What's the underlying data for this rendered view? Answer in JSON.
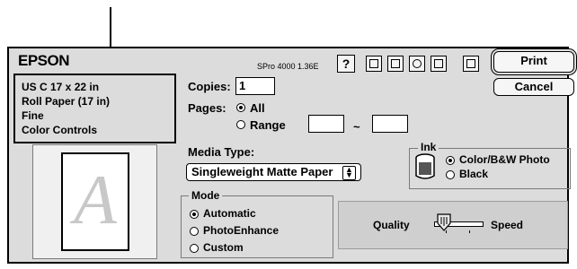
{
  "logo": "EPSON",
  "version": "SPro 4000 1.36E",
  "toolbar": {
    "help_label": "?"
  },
  "buttons": {
    "print": "Print",
    "cancel": "Cancel"
  },
  "summary": [
    "US C 17 x 22 in",
    "Roll Paper (17 in)",
    "Fine",
    "Color Controls"
  ],
  "preview": {
    "glyph": "A"
  },
  "copies": {
    "label": "Copies:",
    "value": "1"
  },
  "pages": {
    "label": "Pages:",
    "all": "All",
    "range": "Range",
    "from": "",
    "to": "",
    "sep": "~",
    "selected": "All"
  },
  "media": {
    "label": "Media Type:",
    "value": "Singleweight Matte Paper"
  },
  "ink": {
    "title": "Ink",
    "options": [
      "Color/B&W Photo",
      "Black"
    ],
    "selected": "Color/B&W Photo"
  },
  "mode": {
    "title": "Mode",
    "options": [
      "Automatic",
      "PhotoEnhance",
      "Custom"
    ],
    "selected": "Automatic"
  },
  "slider": {
    "left_label": "Quality",
    "right_label": "Speed",
    "level": 0.15
  }
}
